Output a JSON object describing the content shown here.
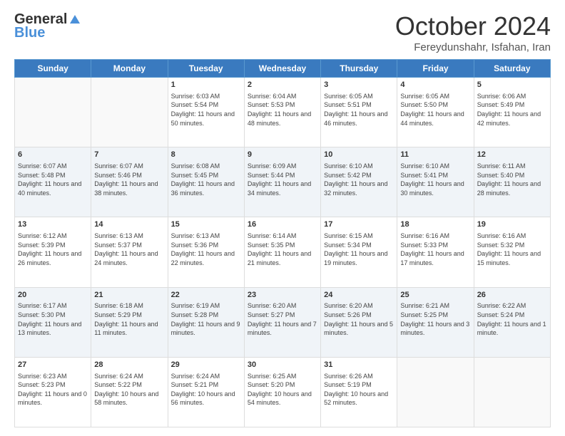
{
  "header": {
    "logo_general": "General",
    "logo_blue": "Blue",
    "month_title": "October 2024",
    "subtitle": "Fereydunshahr, Isfahan, Iran"
  },
  "weekdays": [
    "Sunday",
    "Monday",
    "Tuesday",
    "Wednesday",
    "Thursday",
    "Friday",
    "Saturday"
  ],
  "weeks": [
    [
      {
        "day": "",
        "info": ""
      },
      {
        "day": "",
        "info": ""
      },
      {
        "day": "1",
        "info": "Sunrise: 6:03 AM\nSunset: 5:54 PM\nDaylight: 11 hours and 50 minutes."
      },
      {
        "day": "2",
        "info": "Sunrise: 6:04 AM\nSunset: 5:53 PM\nDaylight: 11 hours and 48 minutes."
      },
      {
        "day": "3",
        "info": "Sunrise: 6:05 AM\nSunset: 5:51 PM\nDaylight: 11 hours and 46 minutes."
      },
      {
        "day": "4",
        "info": "Sunrise: 6:05 AM\nSunset: 5:50 PM\nDaylight: 11 hours and 44 minutes."
      },
      {
        "day": "5",
        "info": "Sunrise: 6:06 AM\nSunset: 5:49 PM\nDaylight: 11 hours and 42 minutes."
      }
    ],
    [
      {
        "day": "6",
        "info": "Sunrise: 6:07 AM\nSunset: 5:48 PM\nDaylight: 11 hours and 40 minutes."
      },
      {
        "day": "7",
        "info": "Sunrise: 6:07 AM\nSunset: 5:46 PM\nDaylight: 11 hours and 38 minutes."
      },
      {
        "day": "8",
        "info": "Sunrise: 6:08 AM\nSunset: 5:45 PM\nDaylight: 11 hours and 36 minutes."
      },
      {
        "day": "9",
        "info": "Sunrise: 6:09 AM\nSunset: 5:44 PM\nDaylight: 11 hours and 34 minutes."
      },
      {
        "day": "10",
        "info": "Sunrise: 6:10 AM\nSunset: 5:42 PM\nDaylight: 11 hours and 32 minutes."
      },
      {
        "day": "11",
        "info": "Sunrise: 6:10 AM\nSunset: 5:41 PM\nDaylight: 11 hours and 30 minutes."
      },
      {
        "day": "12",
        "info": "Sunrise: 6:11 AM\nSunset: 5:40 PM\nDaylight: 11 hours and 28 minutes."
      }
    ],
    [
      {
        "day": "13",
        "info": "Sunrise: 6:12 AM\nSunset: 5:39 PM\nDaylight: 11 hours and 26 minutes."
      },
      {
        "day": "14",
        "info": "Sunrise: 6:13 AM\nSunset: 5:37 PM\nDaylight: 11 hours and 24 minutes."
      },
      {
        "day": "15",
        "info": "Sunrise: 6:13 AM\nSunset: 5:36 PM\nDaylight: 11 hours and 22 minutes."
      },
      {
        "day": "16",
        "info": "Sunrise: 6:14 AM\nSunset: 5:35 PM\nDaylight: 11 hours and 21 minutes."
      },
      {
        "day": "17",
        "info": "Sunrise: 6:15 AM\nSunset: 5:34 PM\nDaylight: 11 hours and 19 minutes."
      },
      {
        "day": "18",
        "info": "Sunrise: 6:16 AM\nSunset: 5:33 PM\nDaylight: 11 hours and 17 minutes."
      },
      {
        "day": "19",
        "info": "Sunrise: 6:16 AM\nSunset: 5:32 PM\nDaylight: 11 hours and 15 minutes."
      }
    ],
    [
      {
        "day": "20",
        "info": "Sunrise: 6:17 AM\nSunset: 5:30 PM\nDaylight: 11 hours and 13 minutes."
      },
      {
        "day": "21",
        "info": "Sunrise: 6:18 AM\nSunset: 5:29 PM\nDaylight: 11 hours and 11 minutes."
      },
      {
        "day": "22",
        "info": "Sunrise: 6:19 AM\nSunset: 5:28 PM\nDaylight: 11 hours and 9 minutes."
      },
      {
        "day": "23",
        "info": "Sunrise: 6:20 AM\nSunset: 5:27 PM\nDaylight: 11 hours and 7 minutes."
      },
      {
        "day": "24",
        "info": "Sunrise: 6:20 AM\nSunset: 5:26 PM\nDaylight: 11 hours and 5 minutes."
      },
      {
        "day": "25",
        "info": "Sunrise: 6:21 AM\nSunset: 5:25 PM\nDaylight: 11 hours and 3 minutes."
      },
      {
        "day": "26",
        "info": "Sunrise: 6:22 AM\nSunset: 5:24 PM\nDaylight: 11 hours and 1 minute."
      }
    ],
    [
      {
        "day": "27",
        "info": "Sunrise: 6:23 AM\nSunset: 5:23 PM\nDaylight: 11 hours and 0 minutes."
      },
      {
        "day": "28",
        "info": "Sunrise: 6:24 AM\nSunset: 5:22 PM\nDaylight: 10 hours and 58 minutes."
      },
      {
        "day": "29",
        "info": "Sunrise: 6:24 AM\nSunset: 5:21 PM\nDaylight: 10 hours and 56 minutes."
      },
      {
        "day": "30",
        "info": "Sunrise: 6:25 AM\nSunset: 5:20 PM\nDaylight: 10 hours and 54 minutes."
      },
      {
        "day": "31",
        "info": "Sunrise: 6:26 AM\nSunset: 5:19 PM\nDaylight: 10 hours and 52 minutes."
      },
      {
        "day": "",
        "info": ""
      },
      {
        "day": "",
        "info": ""
      }
    ]
  ]
}
